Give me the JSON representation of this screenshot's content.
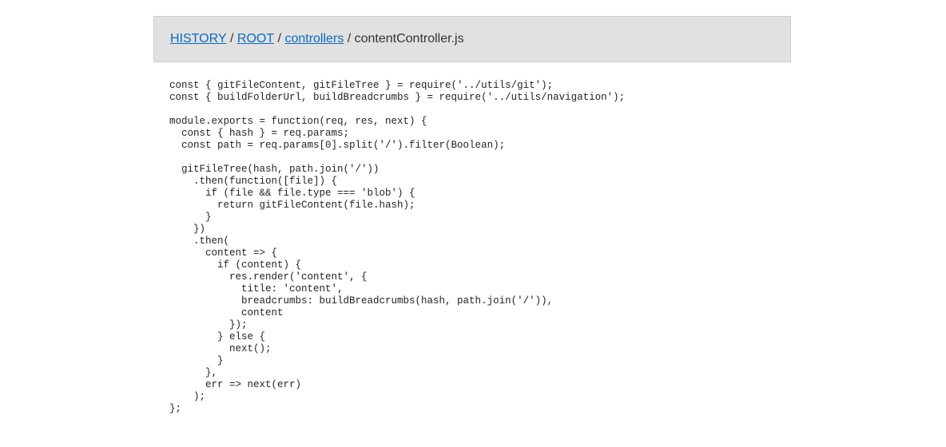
{
  "breadcrumbs": {
    "items": [
      {
        "label": "HISTORY",
        "link": true
      },
      {
        "label": "ROOT",
        "link": true
      },
      {
        "label": "controllers",
        "link": true
      },
      {
        "label": "contentController.js",
        "link": false
      }
    ],
    "separator": " / "
  },
  "file": {
    "lines": [
      "const { gitFileContent, gitFileTree } = require('../utils/git');",
      "const { buildFolderUrl, buildBreadcrumbs } = require('../utils/navigation');",
      "",
      "module.exports = function(req, res, next) {",
      "  const { hash } = req.params;",
      "  const path = req.params[0].split('/').filter(Boolean);",
      "",
      "  gitFileTree(hash, path.join('/'))",
      "    .then(function([file]) {",
      "      if (file && file.type === 'blob') {",
      "        return gitFileContent(file.hash);",
      "      }",
      "    })",
      "    .then(",
      "      content => {",
      "        if (content) {",
      "          res.render('content', {",
      "            title: 'content',",
      "            breadcrumbs: buildBreadcrumbs(hash, path.join('/')),",
      "            content",
      "          });",
      "        } else {",
      "          next();",
      "        }",
      "      },",
      "      err => next(err)",
      "    );",
      "};"
    ]
  }
}
